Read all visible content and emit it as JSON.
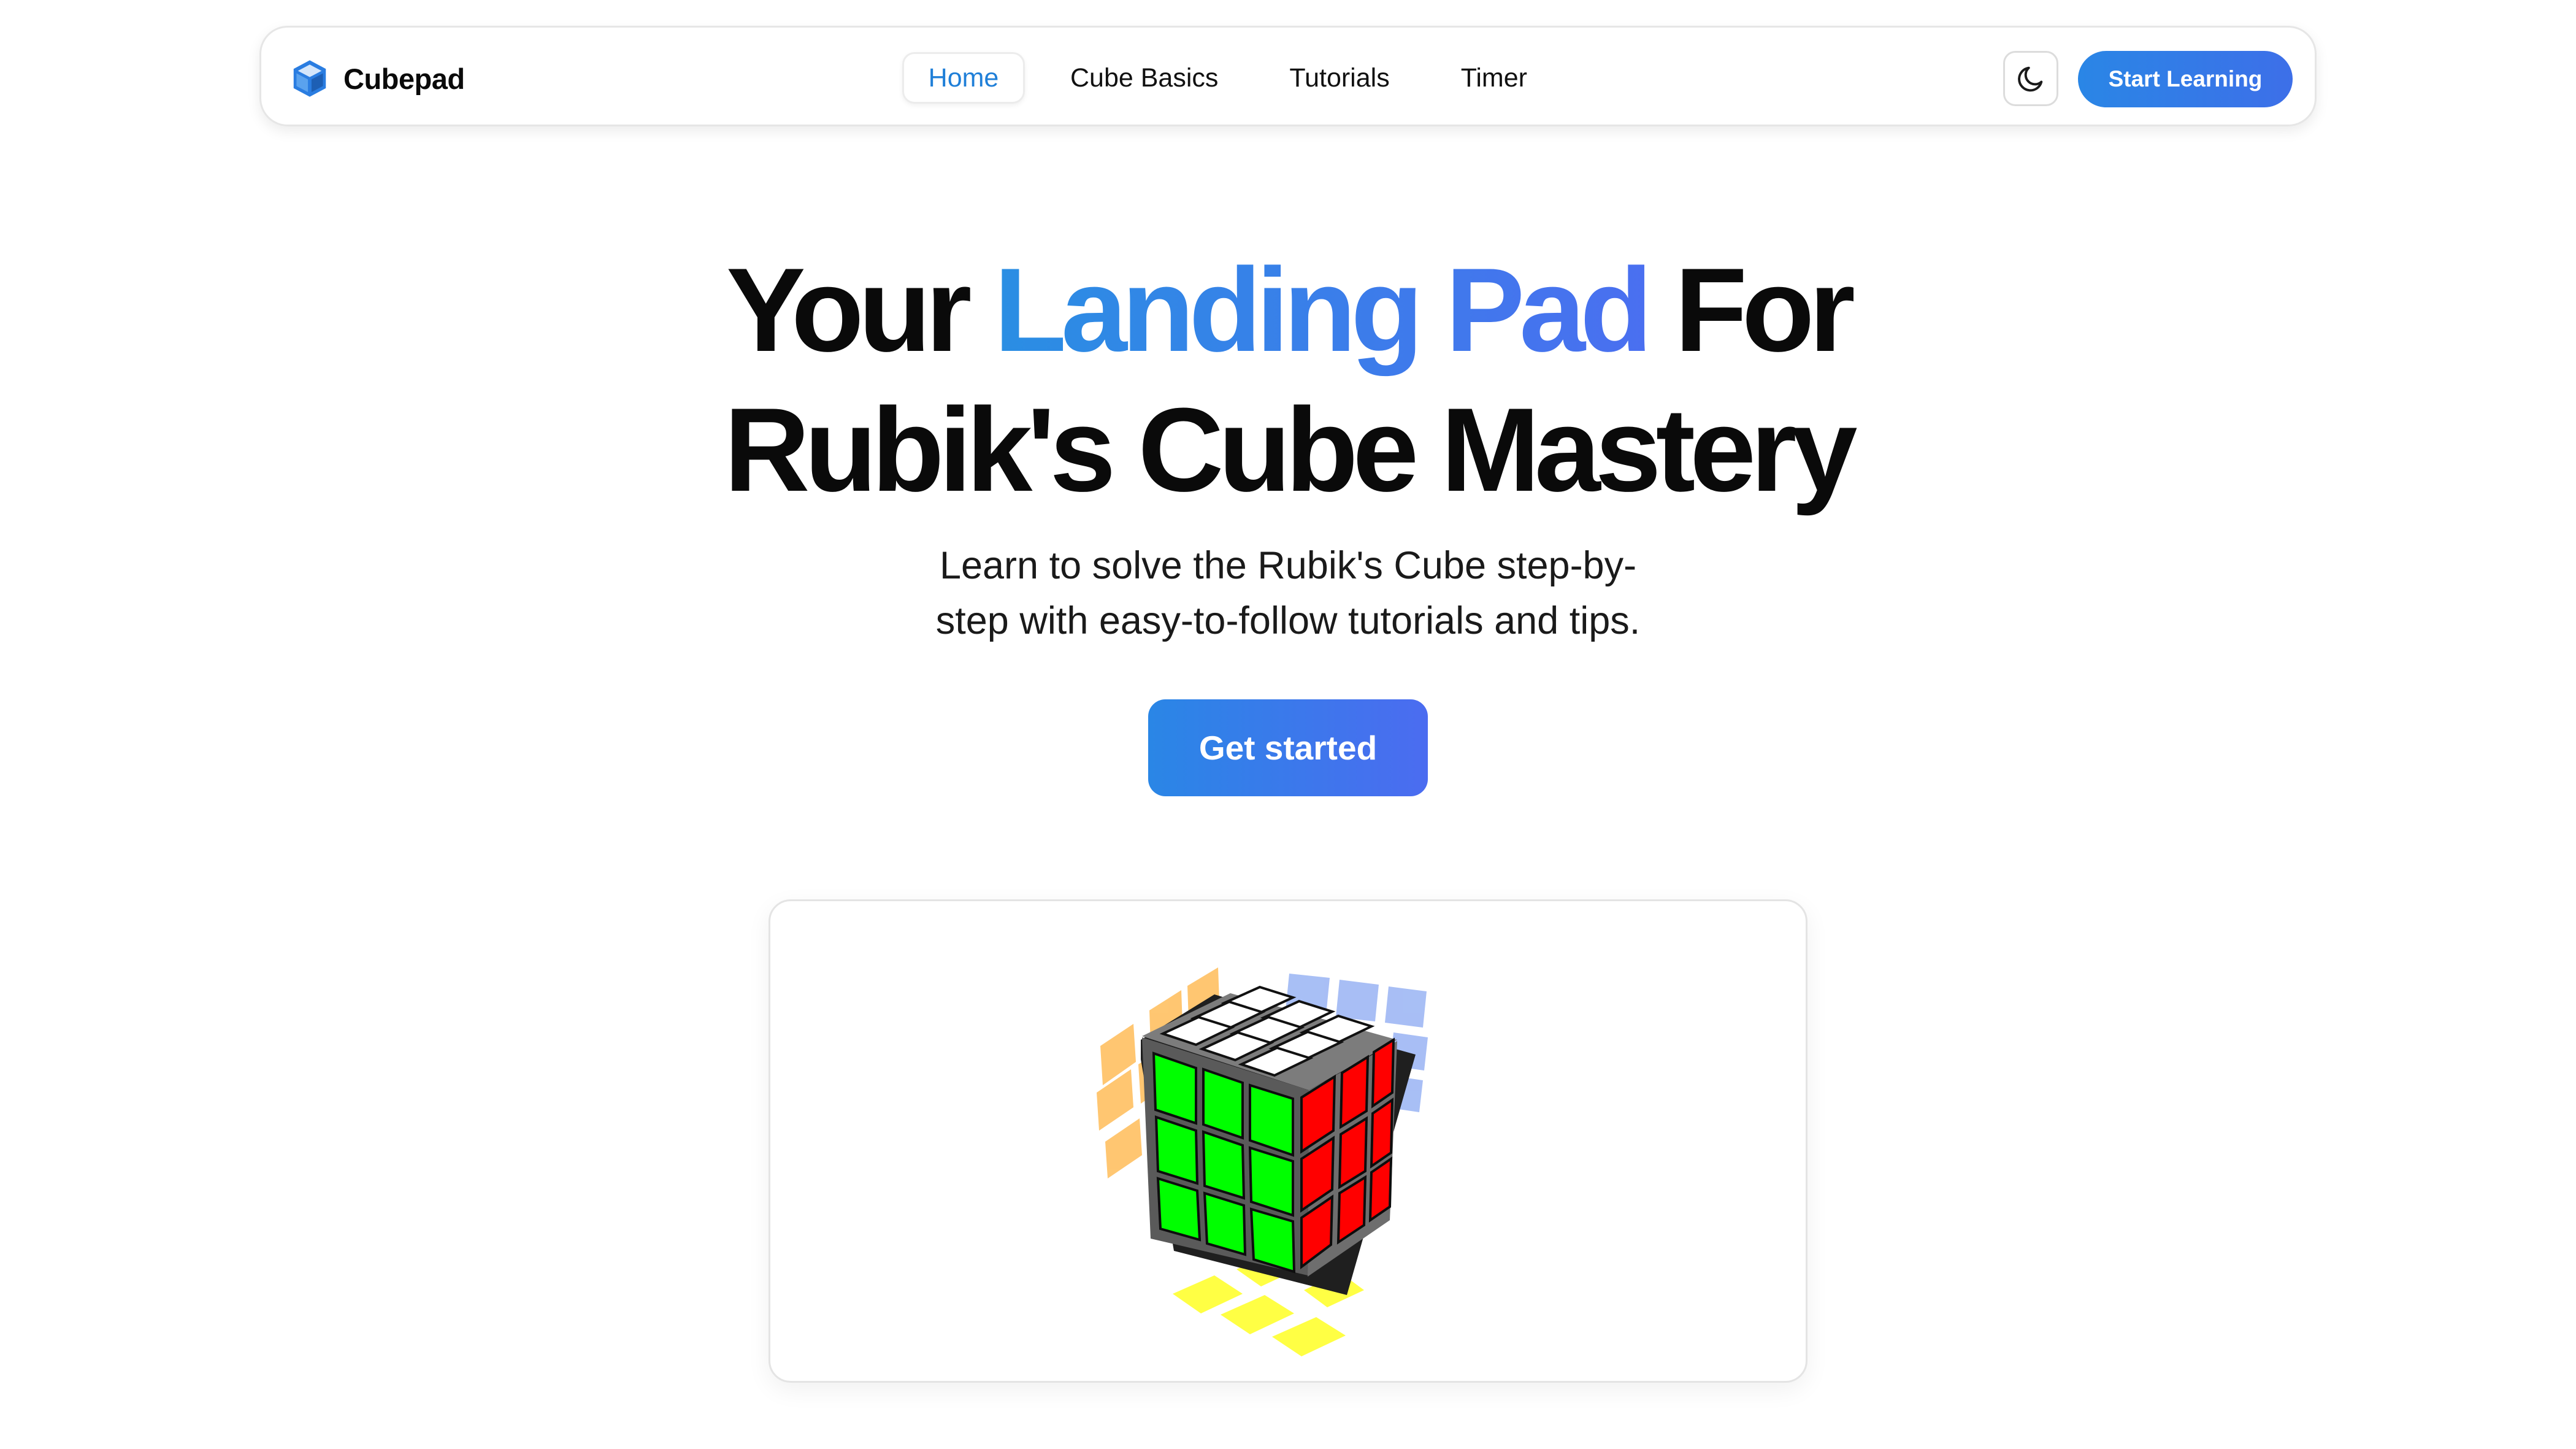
{
  "brand": {
    "name": "Cubepad",
    "icon": "cube-logo-icon",
    "color": "#2a7de1"
  },
  "nav": {
    "links": [
      {
        "label": "Home",
        "active": true
      },
      {
        "label": "Cube Basics",
        "active": false
      },
      {
        "label": "Tutorials",
        "active": false
      },
      {
        "label": "Timer",
        "active": false
      }
    ],
    "theme_toggle_icon": "moon-icon",
    "cta_label": "Start Learning"
  },
  "hero": {
    "title_line1_before": "Your ",
    "title_line1_highlight": "Landing Pad",
    "title_line1_after": " For",
    "title_line2": "Rubik's Cube Mastery",
    "subtitle_line1": "Learn to solve the Rubik's Cube step-by-",
    "subtitle_line2": "step with easy-to-follow tutorials and tips.",
    "cta_label": "Get started"
  },
  "cube_preview": {
    "icon": "rubiks-cube-3d-illustration",
    "face_colors": {
      "top": "#ffffff",
      "front": "#00ff00",
      "right": "#ff0000",
      "left_ghost": "#ffc46a",
      "back_ghost": "#9fb8f4",
      "bottom_ghost": "#ffff3a"
    }
  },
  "colors": {
    "accent": "#2a86e6",
    "accent_end": "#4b6cf0",
    "active_link": "#1f7fd8"
  }
}
